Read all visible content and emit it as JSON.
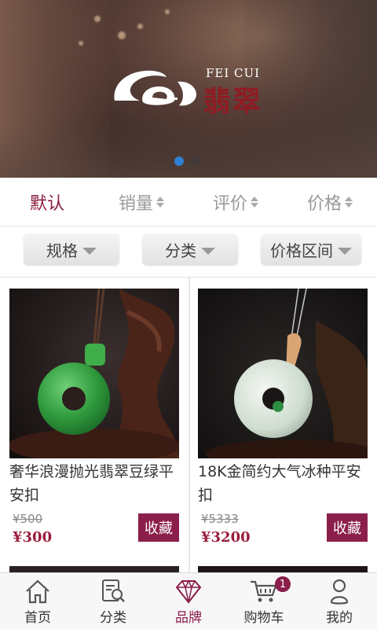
{
  "banner": {
    "logo_en": "FEI CUI",
    "logo_cn": "翡翠",
    "slides": 2,
    "active_slide": 0
  },
  "sort_tabs": [
    {
      "label": "默认",
      "active": true
    },
    {
      "label": "销量",
      "active": false
    },
    {
      "label": "评价",
      "active": false
    },
    {
      "label": "价格",
      "active": false
    }
  ],
  "filters": [
    {
      "label": "规格"
    },
    {
      "label": "分类"
    },
    {
      "label": "价格区间"
    }
  ],
  "products": [
    {
      "title": "奢华浪漫抛光翡翠豆绿平安扣",
      "old_price": "¥500",
      "price": "¥300",
      "fav_label": "收藏"
    },
    {
      "title": "18K金简约大气冰种平安扣",
      "old_price": "¥5333",
      "price": "¥3200",
      "fav_label": "收藏"
    }
  ],
  "bottom_nav": [
    {
      "label": "首页",
      "icon": "home-icon",
      "active": false
    },
    {
      "label": "分类",
      "icon": "category-search-icon",
      "active": false
    },
    {
      "label": "品牌",
      "icon": "diamond-icon",
      "active": true
    },
    {
      "label": "购物车",
      "icon": "cart-icon",
      "active": false,
      "badge": "1"
    },
    {
      "label": "我的",
      "icon": "user-icon",
      "active": false
    }
  ],
  "colors": {
    "accent": "#8a1c4a",
    "active_dot": "#2f7fd3",
    "logo_red": "#8f1c24"
  }
}
